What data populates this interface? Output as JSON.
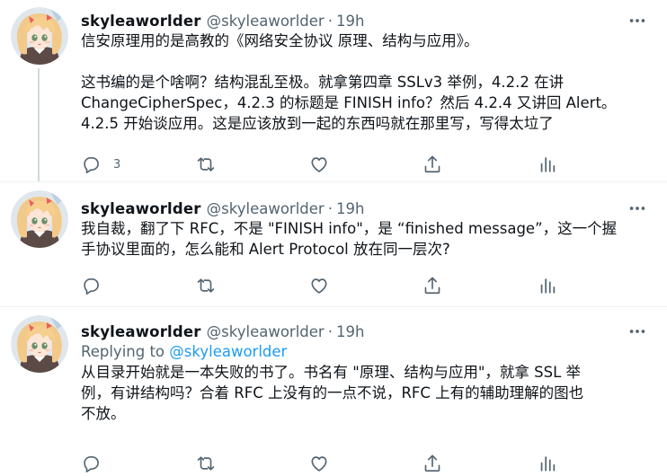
{
  "tweets": [
    {
      "name": "skyleaworlder",
      "handle": "@skyleaworlder",
      "dot": "·",
      "time": "19h",
      "reply_prefix": "",
      "reply_mention": "",
      "lines": [
        "信安原理用的是高教的《网络安全协议 原理、结构与应用》。",
        "这书编的是个啥啊？结构混乱至极。就拿第四章 SSLv3 举例，4.2.2 在讲",
        "ChangeCipherSpec，4.2.3 的标题是 FINISH info？然后 4.2.4 又讲回 Alert。",
        "4.2.5 开始谈应用。这是应该放到一起的东西吗就在那里写，写得太垃了"
      ],
      "reply_count": "3"
    },
    {
      "name": "skyleaworlder",
      "handle": "@skyleaworlder",
      "dot": "·",
      "time": "19h",
      "lines": [
        "我自裁，翻了下 RFC，不是 \"FINISH info\"，是 “finished message”，这一个握",
        "手协议里面的，怎么能和 Alert Protocol 放在同一层次?"
      ]
    },
    {
      "name": "skyleaworlder",
      "handle": "@skyleaworlder",
      "dot": "·",
      "time": "19h",
      "reply_prefix": "Replying to ",
      "reply_mention": "@skyleaworlder",
      "lines": [
        "从目录开始就是一本失败的书了。书名有 \"原理、结构与应用\"，就拿 SSL 举",
        "例，有讲结构吗？合着 RFC 上没有的一点不说，RFC 上有的辅助理解的图也",
        "不放。"
      ]
    }
  ],
  "icons": {
    "reply": "reply-icon",
    "retweet": "retweet-icon",
    "like": "heart-icon",
    "share": "share-icon",
    "analytics": "analytics-icon",
    "more": "more-icon"
  },
  "colors": {
    "text": "#0f1419",
    "secondary": "#536471",
    "link": "#1d9bf0",
    "divider": "#eff3f4",
    "thread_line": "#cfd9de"
  }
}
